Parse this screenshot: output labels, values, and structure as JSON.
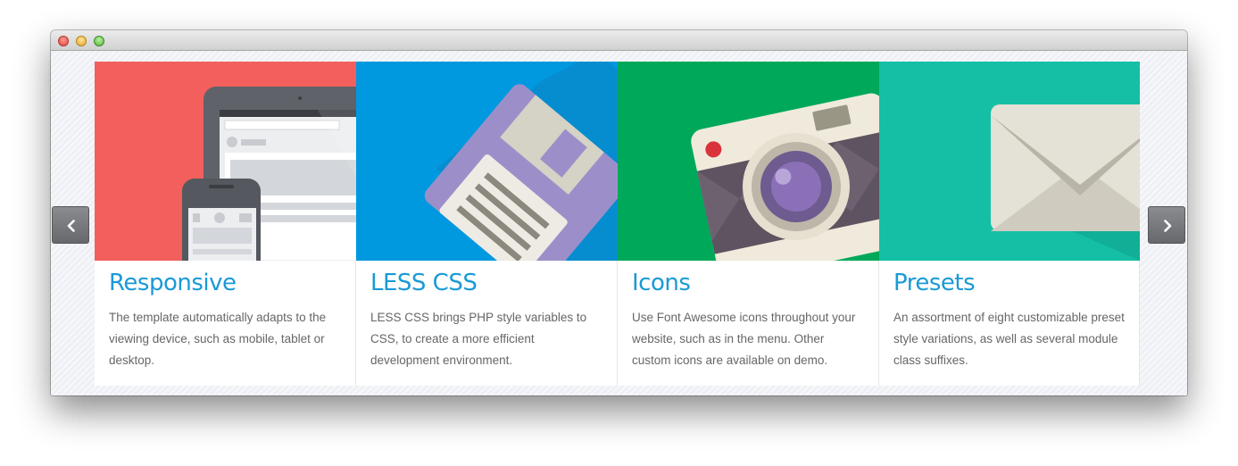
{
  "window": {
    "controls": [
      "close",
      "minimize",
      "zoom"
    ]
  },
  "navigation": {
    "prev_icon": "chevron-left-icon",
    "next_icon": "chevron-right-icon"
  },
  "colors": {
    "accent": "#1a9ad6",
    "responsive_bg": "#f25f5c",
    "lesscss_bg": "#0098de",
    "icons_bg": "#00a85a",
    "presets_bg": "#14bfa6"
  },
  "cards": [
    {
      "title": "Responsive",
      "text": "The template automatically adapts to the viewing device, such as mobile, tablet or desktop.",
      "illustration": "devices-icon"
    },
    {
      "title": "LESS CSS",
      "text": "LESS CSS brings PHP style variables to CSS, to create a more efficient development environment.",
      "illustration": "floppy-disk-icon"
    },
    {
      "title": "Icons",
      "text": "Use Font Awesome icons throughout your website, such as in the menu. Other custom icons are available on demo.",
      "illustration": "camera-icon"
    },
    {
      "title": "Presets",
      "text": "An assortment of eight customizable preset style variations, as well as several module class suffixes.",
      "illustration": "envelope-icon"
    }
  ]
}
